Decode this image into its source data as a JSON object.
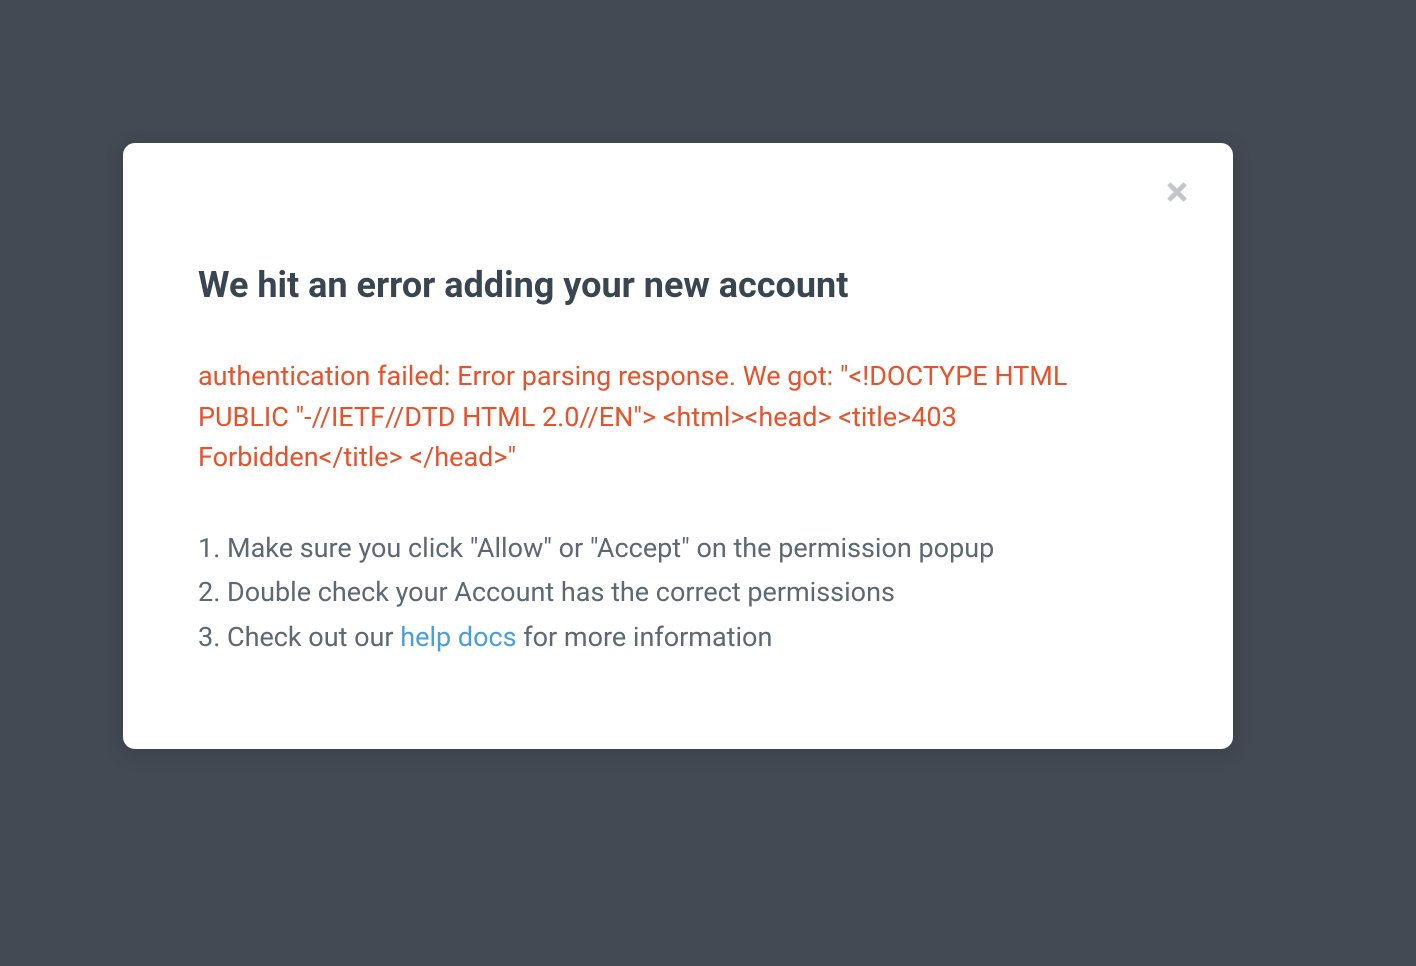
{
  "modal": {
    "title": "We hit an error adding your new account",
    "error_message": "authentication failed: Error parsing response. We got: \"<!DOCTYPE HTML PUBLIC \"-//IETF//DTD HTML 2.0//EN\"> <html><head> <title>403 Forbidden</title> </head>\"",
    "steps": [
      "Make sure you click \"Allow\" or \"Accept\" on the permission popup",
      "Double check your Account has the correct permissions"
    ],
    "step3_prefix": "Check out our ",
    "step3_link_text": "help docs",
    "step3_suffix": " for more information"
  },
  "colors": {
    "background": "#434a53",
    "modal_bg": "#ffffff",
    "title_text": "#3a4552",
    "error_text": "#e8522a",
    "body_text": "#5c6873",
    "link_text": "#4a9ee0",
    "close_icon": "#c0c6cc"
  }
}
